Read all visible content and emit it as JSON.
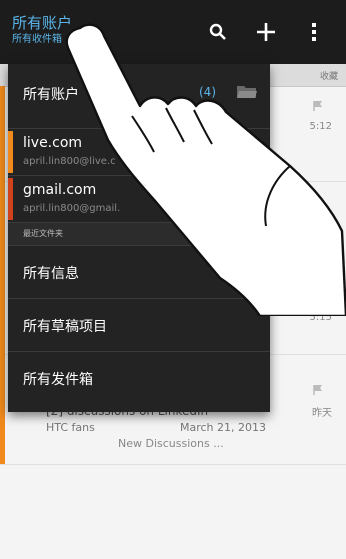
{
  "header": {
    "title": "所有账户",
    "subtitle": "所有收件箱",
    "icons": [
      "search-icon",
      "plus-icon",
      "more-icon"
    ]
  },
  "list": {
    "tab_label": "收藏",
    "times": [
      "5:12",
      "5:15",
      "昨天"
    ],
    "last_row": {
      "subject": "[2] discussions on LinkedIn",
      "sender": "HTC fans",
      "date": "March 21, 2013",
      "preview": "New Discussions ..."
    }
  },
  "dropdown": {
    "all_accounts_label": "所有账户",
    "all_accounts_count": "(4)",
    "accounts": [
      {
        "name": "live.com",
        "email": "april.lin800@live.c",
        "color": "#f08a1c"
      },
      {
        "name": "gmail.com",
        "email": "april.lin800@gmail.",
        "color": "#d0421b"
      }
    ],
    "section_label": "最近文件夹",
    "items": [
      "所有信息",
      "所有草稿项目",
      "所有发件箱"
    ]
  },
  "colors": {
    "accent": "#5ab4e8",
    "orange": "#f08a1c",
    "red": "#d0421b"
  }
}
